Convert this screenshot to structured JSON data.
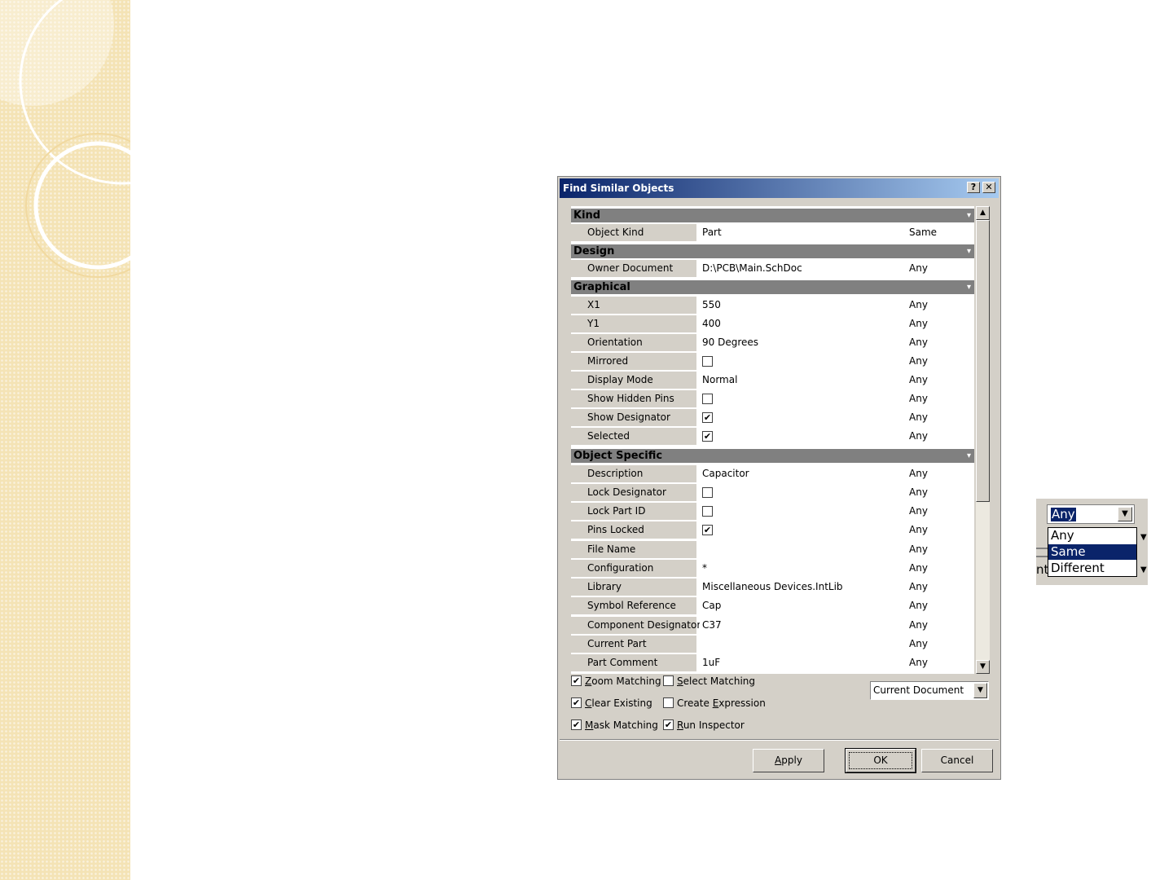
{
  "dialog": {
    "title": "Find Similar Objects",
    "help_label": "?",
    "close_label": "✕"
  },
  "categories": {
    "kind": "Kind",
    "design": "Design",
    "graphical": "Graphical",
    "object_specific": "Object Specific"
  },
  "rows": {
    "object_kind": {
      "label": "Object Kind",
      "value": "Part",
      "mode": "Same"
    },
    "owner_document": {
      "label": "Owner Document",
      "value": "D:\\PCB\\Main.SchDoc",
      "mode": "Any"
    },
    "x1": {
      "label": "X1",
      "value": "550",
      "mode": "Any"
    },
    "y1": {
      "label": "Y1",
      "value": "400",
      "mode": "Any"
    },
    "orientation": {
      "label": "Orientation",
      "value": "90 Degrees",
      "mode": "Any"
    },
    "mirrored": {
      "label": "Mirrored",
      "checked": false,
      "mode": "Any"
    },
    "display_mode": {
      "label": "Display Mode",
      "value": "Normal",
      "mode": "Any"
    },
    "show_hidden_pins": {
      "label": "Show Hidden Pins",
      "checked": false,
      "mode": "Any"
    },
    "show_designator": {
      "label": "Show Designator",
      "checked": true,
      "mode": "Any"
    },
    "selected": {
      "label": "Selected",
      "checked": true,
      "mode": "Any"
    },
    "description": {
      "label": "Description",
      "value": "Capacitor",
      "mode": "Any"
    },
    "lock_designator": {
      "label": "Lock Designator",
      "checked": false,
      "mode": "Any"
    },
    "lock_part_id": {
      "label": "Lock Part ID",
      "checked": false,
      "mode": "Any"
    },
    "pins_locked": {
      "label": "Pins Locked",
      "checked": true,
      "mode": "Any"
    },
    "file_name": {
      "label": "File Name",
      "value": "",
      "mode": "Any"
    },
    "configuration": {
      "label": "Configuration",
      "value": "*",
      "mode": "Any"
    },
    "library": {
      "label": "Library",
      "value": "Miscellaneous Devices.IntLib",
      "mode": "Any"
    },
    "symbol_reference": {
      "label": "Symbol Reference",
      "value": "Cap",
      "mode": "Any"
    },
    "component_designator": {
      "label": "Component Designator",
      "value": "C37",
      "mode": "Any"
    },
    "current_part": {
      "label": "Current Part",
      "value": "",
      "mode": "Any"
    },
    "part_comment": {
      "label": "Part Comment",
      "value": "1uF",
      "mode": "Any"
    }
  },
  "options": {
    "zoom_matching": {
      "first": "Z",
      "rest": "oom Matching",
      "checked": true
    },
    "select_matching": {
      "first": "S",
      "rest": "elect Matching",
      "checked": false
    },
    "clear_existing": {
      "first": "C",
      "rest": "lear Existing",
      "checked": true
    },
    "create_expression": {
      "pre": "Create ",
      "first": "E",
      "rest": "xpression",
      "checked": false
    },
    "mask_matching": {
      "first": "M",
      "rest": "ask Matching",
      "checked": true
    },
    "run_inspector": {
      "first": "R",
      "rest": "un Inspector",
      "checked": true
    }
  },
  "scope": {
    "value": "Current Document"
  },
  "buttons": {
    "apply": {
      "first": "A",
      "rest": "pply"
    },
    "ok": "OK",
    "cancel": "Cancel"
  },
  "dropdown_inset": {
    "selected": "Any",
    "options": [
      "Any",
      "Same",
      "Different"
    ],
    "highlighted": "Same",
    "partial_label": "nt"
  },
  "colors": {
    "titlebar_start": "#0a246a",
    "titlebar_end": "#a6caf0",
    "highlight": "#0a246a",
    "face": "#d4d0c8",
    "category": "#808080"
  }
}
